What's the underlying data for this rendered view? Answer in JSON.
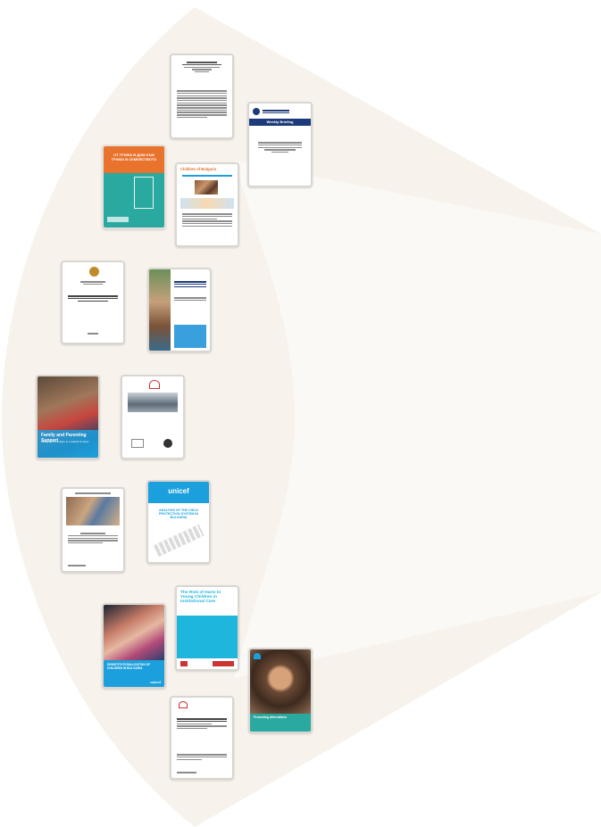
{
  "colors": {
    "fan_fill": "#f7f3ec",
    "card_border": "#d9d6d2",
    "unicef_blue": "#1ca0dd",
    "teal": "#2aa9a0",
    "orange": "#e9722c",
    "navy": "#1d3b7a",
    "cyan_panel": "#1fb6dd"
  },
  "documents": [
    {
      "id": "doc1",
      "type": "text-report",
      "icon": "document-icon"
    },
    {
      "id": "doc2",
      "type": "weekly-briefing",
      "masthead": "Weekly Briefing",
      "icon": "document-icon"
    },
    {
      "id": "doc3",
      "type": "cover-orange-teal",
      "title": "ОТ ГРИЖА В ДОМ КЪМ ГРИЖА В СЕМЕЙСТВОТО",
      "icon": "document-icon"
    },
    {
      "id": "doc4",
      "type": "web-article",
      "masthead": "Children of Bulgaria",
      "icon": "document-icon"
    },
    {
      "id": "doc5",
      "type": "government-report",
      "icon": "coat-of-arms-icon"
    },
    {
      "id": "doc6",
      "type": "photo-report",
      "icon": "document-icon"
    },
    {
      "id": "doc7",
      "type": "photo-cover",
      "title": "Family and Parenting Support",
      "subtitle": "Policy and Provision in a Global Context",
      "icon": "document-icon"
    },
    {
      "id": "doc8",
      "type": "conference-report",
      "icon": "document-icon"
    },
    {
      "id": "doc9",
      "type": "photo-text",
      "icon": "document-icon"
    },
    {
      "id": "doc10",
      "type": "unicef-report",
      "brand": "unicef",
      "title": "ANALYSIS OF THE CHILD PROTECTION SYSTEM IN BULGARIA",
      "icon": "unicef-logo-icon"
    },
    {
      "id": "doc11",
      "type": "photo-cover-blue",
      "title": "DEINSTITUTIONALIZATION OF CHILDREN IN BULGARIA",
      "brand": "unicef",
      "icon": "document-icon"
    },
    {
      "id": "doc12",
      "type": "cyan-report",
      "title": "The Risk of Harm to Young Children in Institutional Care",
      "icon": "document-icon"
    },
    {
      "id": "doc13",
      "type": "child-photo-cover",
      "title": "Promoting Alternatives",
      "icon": "heart-logo-icon"
    },
    {
      "id": "doc14",
      "type": "text-article",
      "icon": "document-icon"
    }
  ]
}
